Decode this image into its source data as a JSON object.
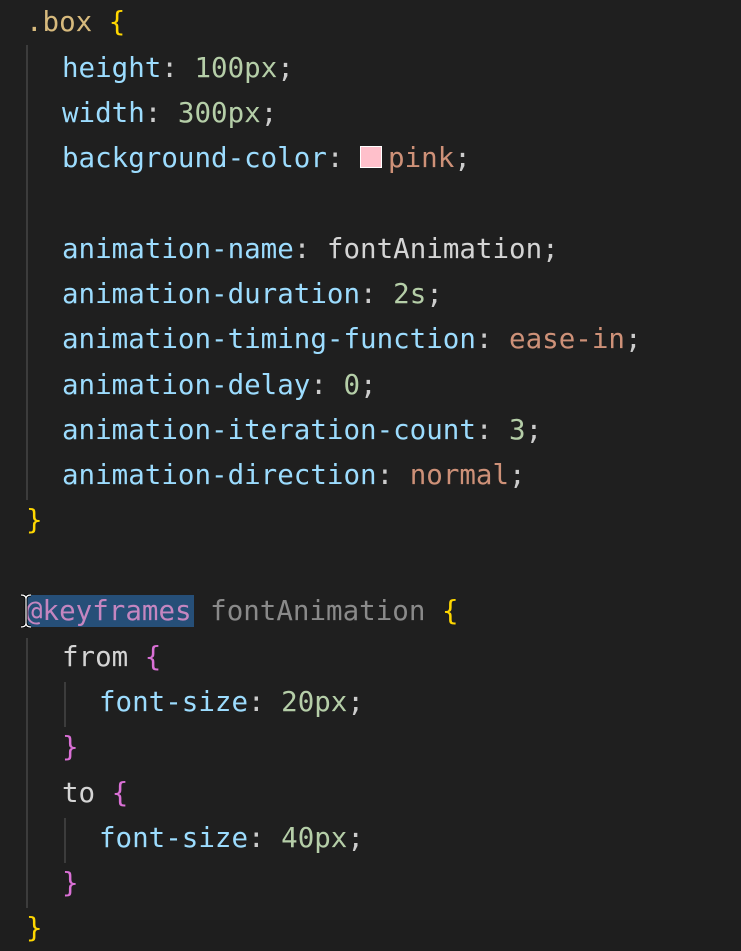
{
  "colors": {
    "background": "#1f1f1f",
    "pink_swatch": "#ffc0cb",
    "selection": "#264f78"
  },
  "code": {
    "selector": ".box",
    "open_brace": "{",
    "close_brace": "}",
    "decls": [
      {
        "prop": "height",
        "value": "100px"
      },
      {
        "prop": "width",
        "value": "300px"
      },
      {
        "prop": "background-color",
        "value": "pink"
      },
      {
        "prop": "animation-name",
        "value": "fontAnimation"
      },
      {
        "prop": "animation-duration",
        "value": "2s"
      },
      {
        "prop": "animation-timing-function",
        "value": "ease-in"
      },
      {
        "prop": "animation-delay",
        "value": "0"
      },
      {
        "prop": "animation-iteration-count",
        "value": "3"
      },
      {
        "prop": "animation-direction",
        "value": "normal"
      }
    ],
    "keyframes": {
      "at_rule": "@keyframes",
      "name": "fontAnimation",
      "from_label": "from",
      "to_label": "to",
      "from_decl": {
        "prop": "font-size",
        "value": "20px"
      },
      "to_decl": {
        "prop": "font-size",
        "value": "40px"
      }
    }
  },
  "icons": {
    "cursor": "text-cursor-icon"
  }
}
